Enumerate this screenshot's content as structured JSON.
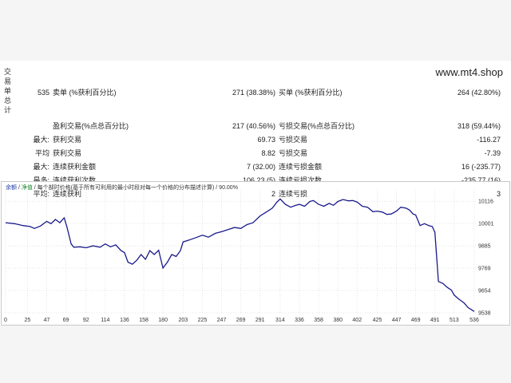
{
  "side_label": [
    "交",
    "易",
    "单",
    "总",
    "计"
  ],
  "watermark": "www.mt4.shop",
  "rows": [
    {
      "c1": "535",
      "c2": "卖单 (%获利百分比)",
      "c3": "271 (38.38%)",
      "c4": "买单 (%获利百分比)",
      "c5": "264 (42.80%)"
    },
    {
      "c1": "",
      "c2": "盈利交易(%点总百分比)",
      "c3": "217 (40.56%)",
      "c4": "亏损交易(%点总百分比)",
      "c5": "318 (59.44%)"
    },
    {
      "c1": "最大:",
      "c2": "获利交易",
      "c3": "69.73",
      "c4": "亏损交易",
      "c5": "-116.27"
    },
    {
      "c1": "平均",
      "c2": "获利交易",
      "c3": "8.82",
      "c4": "亏损交易",
      "c5": "-7.39"
    },
    {
      "c1": "最大:",
      "c2": "连续获利金额",
      "c3": "7 (32.00)",
      "c4": "连续亏损金额",
      "c5": "16 (-235.77)"
    },
    {
      "c1": "最多:",
      "c2": "连续获利次数",
      "c3": "106.23 (5)",
      "c4": "连续亏损次数",
      "c5": "-235.77 (16)"
    },
    {
      "c1": "平均:",
      "c2": "连续获利",
      "c3": "2",
      "c4": "连续亏损",
      "c5": "3"
    }
  ],
  "legend": {
    "balance": "余额",
    "equity": "净值",
    "text": "/ 每个部时价格(基于所有可利用的最小时段对每一个价格的分布描述计算) / 90.00%"
  },
  "colors": {
    "line": "#1a1a8c",
    "grid": "#e4e4e4",
    "balance": "#1a3aa8",
    "equity": "#1a8a2a"
  },
  "chart_data": {
    "type": "line",
    "x_ticks": [
      "0",
      "25",
      "47",
      "69",
      "92",
      "114",
      "136",
      "158",
      "180",
      "203",
      "225",
      "247",
      "269",
      "291",
      "314",
      "336",
      "358",
      "380",
      "402",
      "425",
      "447",
      "469",
      "491",
      "513",
      "536"
    ],
    "y_ticks": [
      "10116",
      "10001",
      "9885",
      "9769",
      "9654",
      "9538"
    ],
    "xlim": [
      0,
      536
    ],
    "ylim": [
      9538,
      10150
    ],
    "series": [
      {
        "x": [
          0,
          10,
          20,
          28,
          33,
          40,
          47,
          52,
          57,
          62,
          67,
          70,
          75,
          78,
          85,
          92,
          100,
          108,
          114,
          120,
          126,
          132,
          136,
          140,
          145,
          150,
          155,
          160,
          165,
          170,
          175,
          180,
          185,
          190,
          195,
          200,
          203,
          210,
          218,
          225,
          232,
          240,
          247,
          255,
          262,
          269,
          276,
          283,
          291,
          298,
          305,
          310,
          314,
          320,
          326,
          332,
          336,
          342,
          348,
          352,
          358,
          364,
          370,
          375,
          380,
          386,
          392,
          397,
          402,
          408,
          414,
          420,
          425,
          431,
          436,
          441,
          447,
          452,
          458,
          462,
          466,
          469,
          474,
          479,
          484,
          488,
          491,
          495,
          500,
          505,
          510,
          513,
          518,
          524,
          529,
          536
        ],
        "y": [
          10005,
          10000,
          9990,
          9985,
          9975,
          9988,
          10012,
          10000,
          10022,
          10005,
          10030,
          9985,
          9895,
          9878,
          9880,
          9875,
          9885,
          9878,
          9895,
          9880,
          9890,
          9860,
          9850,
          9800,
          9790,
          9810,
          9840,
          9815,
          9860,
          9840,
          9862,
          9770,
          9800,
          9840,
          9830,
          9860,
          9905,
          9915,
          9928,
          9940,
          9930,
          9950,
          9958,
          9970,
          9980,
          9975,
          9995,
          10005,
          10040,
          10060,
          10080,
          10110,
          10128,
          10100,
          10085,
          10095,
          10100,
          10090,
          10115,
          10120,
          10100,
          10090,
          10105,
          10095,
          10115,
          10125,
          10118,
          10120,
          10112,
          10090,
          10085,
          10062,
          10065,
          10060,
          10048,
          10050,
          10065,
          10085,
          10080,
          10070,
          10050,
          10045,
          9990,
          10000,
          9990,
          9985,
          9955,
          9700,
          9690,
          9670,
          9655,
          9630,
          9610,
          9590,
          9565,
          9545
        ]
      }
    ]
  }
}
